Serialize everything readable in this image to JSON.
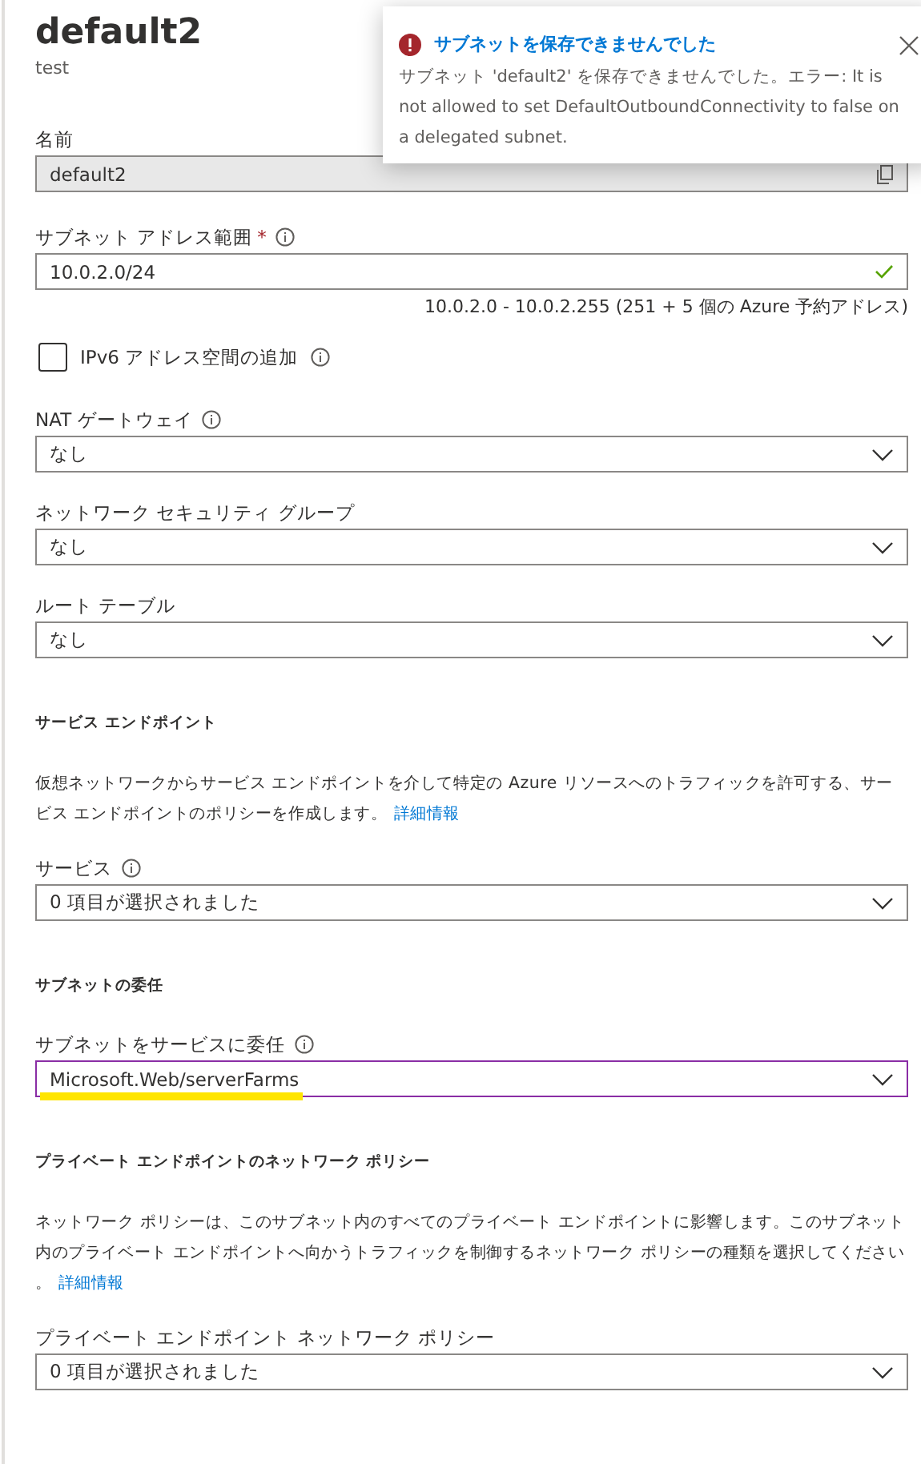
{
  "header": {
    "title": "default2",
    "subtitle": "test"
  },
  "toast": {
    "kind": "error",
    "title": "サブネットを保存できませんでした",
    "message": "サブネット 'default2' を保存できませんでした。エラー: It is not allowed to set DefaultOutboundConnectivity to false on a delegated subnet."
  },
  "form": [
    {
      "kind": "readonly",
      "label": "名前",
      "value": "default2"
    },
    {
      "kind": "text",
      "label": "サブネット アドレス範囲",
      "required": true,
      "required_mark": "*",
      "info": true,
      "value": "10.0.2.0/24",
      "valid": true,
      "hint": "10.0.2.0 - 10.0.2.255 (251 + 5 個の Azure 予約アドレス)"
    },
    {
      "kind": "checkbox",
      "label": "IPv6 アドレス空間の追加",
      "info": true,
      "checked": false
    },
    {
      "kind": "select",
      "label": "NAT ゲートウェイ",
      "info": true,
      "value": "なし",
      "focused": false
    },
    {
      "kind": "select",
      "label": "ネットワーク セキュリティ グループ",
      "value": "なし",
      "focused": false
    },
    {
      "kind": "select",
      "label": "ルート テーブル",
      "value": "なし",
      "focused": false
    },
    {
      "kind": "heading",
      "label": "サービス エンドポイント"
    },
    {
      "kind": "paragraph",
      "text": "仮想ネットワークからサービス エンドポイントを介して特定の Azure リソースへのトラフィックを許可する、サービス エンドポイントのポリシーを作成します。",
      "link": "詳細情報"
    },
    {
      "kind": "select",
      "label": "サービス",
      "info": true,
      "value": "0 項目が選択されました",
      "focused": false
    },
    {
      "kind": "heading",
      "label": "サブネットの委任"
    },
    {
      "kind": "select",
      "label": "サブネットをサービスに委任",
      "info": true,
      "value": "Microsoft.Web/serverFarms",
      "focused": true,
      "highlighted": true
    },
    {
      "kind": "heading",
      "label": "プライベート エンドポイントのネットワーク ポリシー"
    },
    {
      "kind": "paragraph",
      "text": "ネットワーク ポリシーは、このサブネット内のすべてのプライベート エンドポイントに影響します。このサブネット内のプライベート エンドポイントへ向かうトラフィックを制御するネットワーク ポリシーの種類を選択してください。",
      "link": "詳細情報"
    },
    {
      "kind": "select",
      "label": "プライベート エンドポイント ネットワーク ポリシー",
      "value": "0 項目が選択されました",
      "focused": false
    }
  ]
}
